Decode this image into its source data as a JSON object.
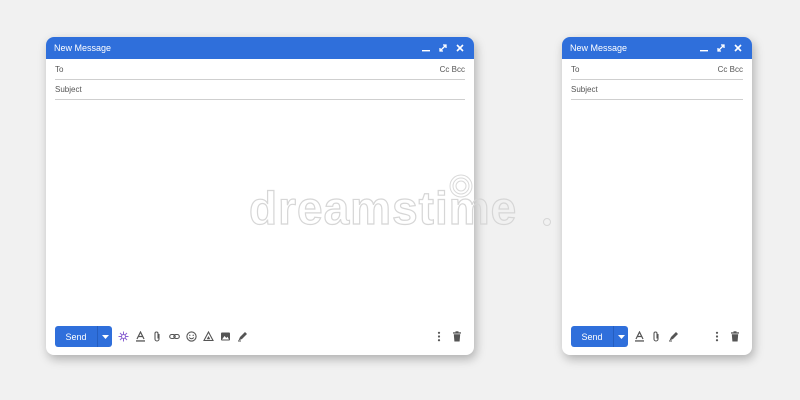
{
  "windows": {
    "large": {
      "title": "New Message",
      "to_label": "To",
      "cc_bcc": "Cc Bcc",
      "subject_placeholder": "Subject",
      "send_label": "Send"
    },
    "small": {
      "title": "New Message",
      "to_label": "To",
      "cc_bcc": "Cc Bcc",
      "subject_placeholder": "Subject",
      "send_label": "Send"
    }
  },
  "icons": {
    "large_toolbar": [
      "ai-sparkle-icon",
      "format-text-icon",
      "attach-icon",
      "link-icon",
      "emoji-icon",
      "drive-icon",
      "image-icon",
      "pen-icon"
    ],
    "small_toolbar": [
      "format-text-icon",
      "attach-icon",
      "pen-icon"
    ],
    "right_toolbar": [
      "more-options-icon",
      "trash-icon"
    ],
    "window_controls": [
      "minimize-icon",
      "expand-icon",
      "close-icon"
    ]
  },
  "watermark": {
    "text": "dreamstime"
  },
  "colors": {
    "accent": "#2f6fdb",
    "background": "#f1f1f1",
    "window": "#ffffff",
    "icon": "#555555",
    "sparkle": "#8a63d2"
  }
}
